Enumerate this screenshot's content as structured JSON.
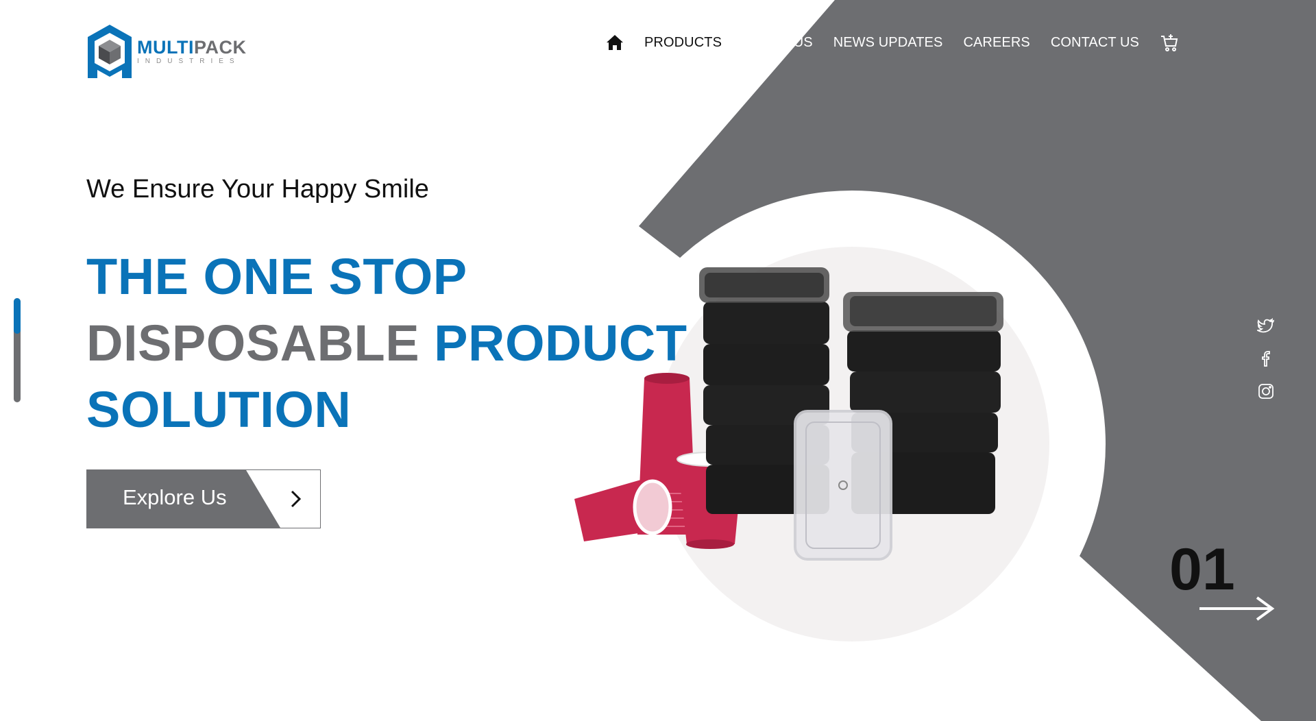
{
  "brand": {
    "name_part1": "MULTI",
    "name_part2": "PACK",
    "tagline": "INDUSTRIES",
    "color_blue": "#0a73b8",
    "color_gray": "#6d6e71"
  },
  "nav": {
    "home_icon": "home-icon",
    "items": [
      {
        "label": "PRODUCTS"
      },
      {
        "label": "ABOUT US"
      },
      {
        "label": "NEWS UPDATES"
      },
      {
        "label": "CAREERS"
      },
      {
        "label": "CONTACT US"
      }
    ],
    "cart_icon": "cart-icon"
  },
  "hero": {
    "tagline": "We Ensure Your Happy Smile",
    "headline_line1": "THE ONE STOP",
    "headline_line2_gray": "DISPOSABLE",
    "headline_line2_blue": "PRODUCT",
    "headline_line3": "SOLUTION",
    "cta_label": "Explore Us"
  },
  "slider": {
    "current": "01"
  },
  "social": [
    "twitter-icon",
    "facebook-icon",
    "instagram-icon"
  ]
}
